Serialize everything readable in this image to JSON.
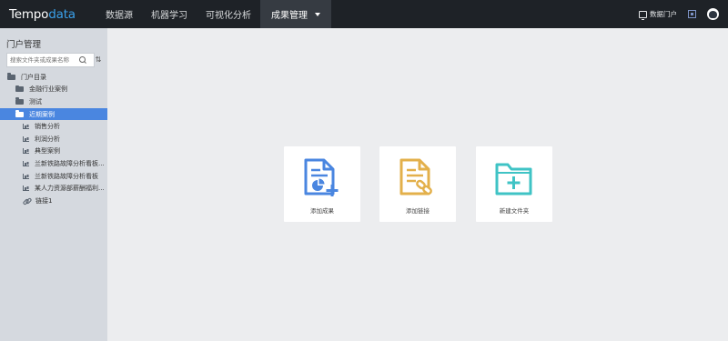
{
  "app": {
    "logo_main": "Tempo",
    "logo_accent": "data"
  },
  "nav": {
    "items": [
      {
        "label": "数据源"
      },
      {
        "label": "机器学习"
      },
      {
        "label": "可视化分析"
      },
      {
        "label": "成果管理",
        "active": true
      }
    ]
  },
  "header_right": {
    "portal_label": "数据门户"
  },
  "sidebar": {
    "title": "门户管理",
    "search_placeholder": "搜索文件夹或成果名称",
    "tree": [
      {
        "label": "门户目录",
        "icon": "folder-icon",
        "level": 0
      },
      {
        "label": "金融行业案例",
        "icon": "folder-icon",
        "level": 1
      },
      {
        "label": "测试",
        "icon": "folder-icon",
        "level": 1
      },
      {
        "label": "近期案例",
        "icon": "folder-icon",
        "level": 1,
        "selected": true
      },
      {
        "label": "销售分析",
        "icon": "chart-icon",
        "level": 2
      },
      {
        "label": "利润分析",
        "icon": "chart-icon",
        "level": 2
      },
      {
        "label": "典型案例",
        "icon": "chart-icon",
        "level": 2
      },
      {
        "label": "兰新铁路故障分析看板...",
        "icon": "chart-icon",
        "level": 2
      },
      {
        "label": "兰新铁路故障分析看板",
        "icon": "chart-icon",
        "level": 2
      },
      {
        "label": "某人力资源部薪酬福利...",
        "icon": "chart-icon",
        "level": 2
      },
      {
        "label": "链接1",
        "icon": "link-icon",
        "level": 2
      }
    ]
  },
  "main": {
    "cards": [
      {
        "label": "添加成果",
        "icon": "add-result-icon",
        "color": "#4a86e0"
      },
      {
        "label": "添加链接",
        "icon": "add-link-icon",
        "color": "#e3b04b"
      },
      {
        "label": "新建文件夹",
        "icon": "new-folder-icon",
        "color": "#3fc3c5"
      }
    ]
  },
  "colors": {
    "topbar": "#1e2227",
    "sidebar": "#d5d9df",
    "selected": "#4a86e0",
    "content_bg": "#ecedef"
  }
}
